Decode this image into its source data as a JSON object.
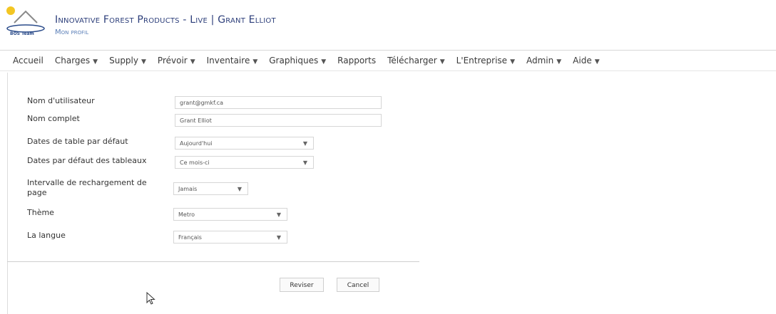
{
  "header": {
    "logo_text": "BOS Team",
    "title": "Innovative Forest Products - Live | Grant Elliot",
    "subtitle": "Mon profil"
  },
  "nav": {
    "items": [
      {
        "label": "Accueil",
        "dropdown": false
      },
      {
        "label": "Charges",
        "dropdown": true
      },
      {
        "label": "Supply",
        "dropdown": true
      },
      {
        "label": "Prévoir",
        "dropdown": true
      },
      {
        "label": "Inventaire",
        "dropdown": true
      },
      {
        "label": "Graphiques",
        "dropdown": true
      },
      {
        "label": "Rapports",
        "dropdown": false
      },
      {
        "label": "Télécharger",
        "dropdown": true
      },
      {
        "label": "L'Entreprise",
        "dropdown": true
      },
      {
        "label": "Admin",
        "dropdown": true
      },
      {
        "label": "Aide",
        "dropdown": true
      }
    ]
  },
  "form": {
    "username_label": "Nom d'utilisateur",
    "username_value": "grant@gmkf.ca",
    "fullname_label": "Nom complet",
    "fullname_value": "Grant Elliot",
    "table_dates_label": "Dates de table par défaut",
    "table_dates_value": "Aujourd'hui",
    "chart_dates_label": "Dates par défaut des tableaux",
    "chart_dates_value": "Ce mois-ci",
    "reload_label": "Intervalle de rechargement de page",
    "reload_value": "Jamais",
    "theme_label": "Thème",
    "theme_value": "Metro",
    "language_label": "La langue",
    "language_value": "Français"
  },
  "actions": {
    "save_label": "Reviser",
    "cancel_label": "Cancel"
  },
  "colors": {
    "title": "#2c3e7a",
    "subtitle": "#5b7fb8"
  }
}
